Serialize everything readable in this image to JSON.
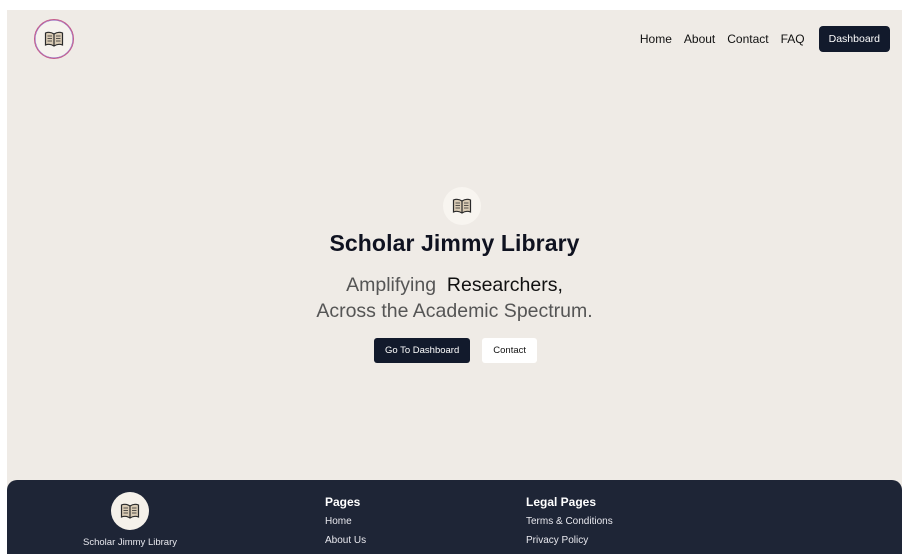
{
  "header": {
    "logo_icon": "open-book-icon",
    "nav": [
      "Home",
      "About",
      "Contact",
      "FAQ"
    ],
    "dashboard_label": "Dashboard"
  },
  "hero": {
    "icon": "open-book-icon",
    "title": "Scholar Jimmy Library",
    "line1_prefix": "Amplifying",
    "line1_highlight": "Researchers,",
    "line2": "Across the Academic Spectrum.",
    "primary_button": "Go To Dashboard",
    "secondary_button": "Contact"
  },
  "footer": {
    "brand_name": "Scholar Jimmy Library",
    "pages_heading": "Pages",
    "pages_links": [
      "Home",
      "About Us"
    ],
    "legal_heading": "Legal Pages",
    "legal_links": [
      "Terms & Conditions",
      "Privacy Policy"
    ]
  },
  "colors": {
    "background": "#efebe6",
    "primary_dark": "#121a2c",
    "footer_bg": "#1e2536",
    "logo_ring": "#c45a8a"
  }
}
